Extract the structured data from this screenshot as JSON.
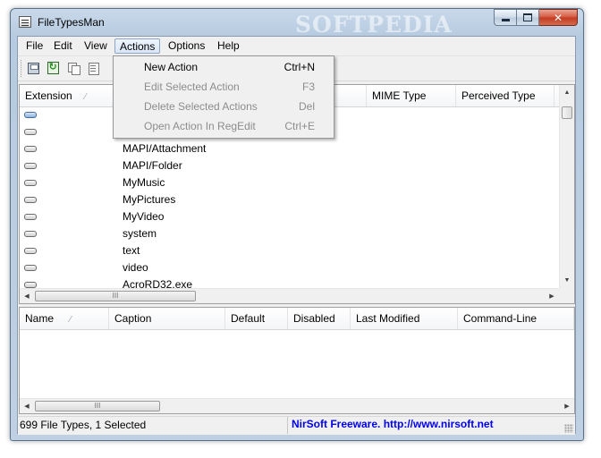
{
  "window": {
    "title": "FileTypesMan",
    "watermark": "SOFTPEDIA"
  },
  "menubar": [
    {
      "label": "File"
    },
    {
      "label": "Edit"
    },
    {
      "label": "View"
    },
    {
      "label": "Actions"
    },
    {
      "label": "Options"
    },
    {
      "label": "Help"
    }
  ],
  "toolbar": {
    "icons": [
      "save-icon",
      "refresh-icon",
      "copy-icon",
      "properties-icon"
    ]
  },
  "top_table": {
    "columns": [
      {
        "label": "Extension"
      },
      {
        "label": "MIME Type"
      },
      {
        "label": "Perceived Type"
      }
    ],
    "rows": [
      {
        "name": "",
        "selected": true
      },
      {
        "name": "",
        "selected": false
      },
      {
        "name": "MAPI/Attachment",
        "selected": false
      },
      {
        "name": "MAPI/Folder",
        "selected": false
      },
      {
        "name": "MyMusic",
        "selected": false
      },
      {
        "name": "MyPictures",
        "selected": false
      },
      {
        "name": "MyVideo",
        "selected": false
      },
      {
        "name": "system",
        "selected": false
      },
      {
        "name": "text",
        "selected": false
      },
      {
        "name": "video",
        "selected": false
      },
      {
        "name": "AcroRD32.exe",
        "selected": false
      }
    ]
  },
  "actions_menu": [
    {
      "label": "New Action",
      "shortcut": "Ctrl+N",
      "enabled": true
    },
    {
      "label": "Edit Selected Action",
      "shortcut": "F3",
      "enabled": false
    },
    {
      "label": "Delete Selected Actions",
      "shortcut": "Del",
      "enabled": false
    },
    {
      "label": "Open Action In RegEdit",
      "shortcut": "Ctrl+E",
      "enabled": false
    }
  ],
  "bottom_table": {
    "columns": [
      {
        "label": "Name"
      },
      {
        "label": "Caption"
      },
      {
        "label": "Default"
      },
      {
        "label": "Disabled"
      },
      {
        "label": "Last Modified"
      },
      {
        "label": "Command-Line"
      }
    ]
  },
  "statusbar": {
    "left": "699 File Types, 1 Selected",
    "right": "NirSoft Freeware.  http://www.nirsoft.net"
  },
  "scroll_glyph": "III"
}
